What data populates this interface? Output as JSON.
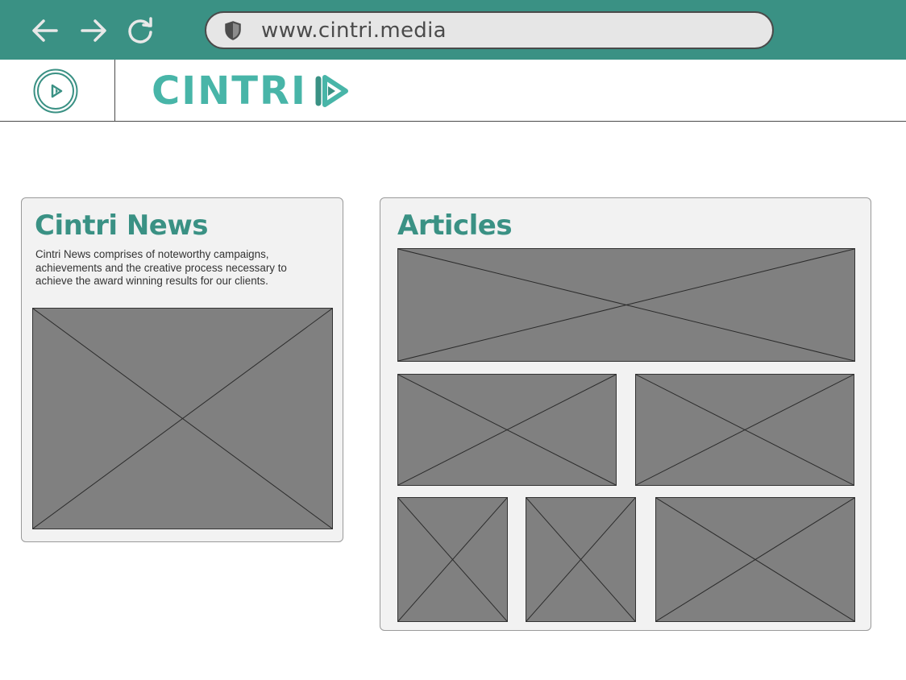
{
  "browser": {
    "url": "www.cintri.media",
    "icons": {
      "back": "arrow-left-icon",
      "forward": "arrow-right-icon",
      "reload": "reload-icon",
      "security": "shield-icon"
    },
    "colors": {
      "bar": "#3a9184",
      "url_bg": "#e6e6e6"
    }
  },
  "header": {
    "brand_name": "CINTRI",
    "icons": {
      "menu": "play-circle-icon",
      "brand_mark": "play-hexagon-icon"
    },
    "colors": {
      "brand": "#48b5a8"
    }
  },
  "news": {
    "title": "Cintri News",
    "description_lines": [
      "Cintri News comprises of noteworthy campaigns,",
      "achievements and the creative process necessary to",
      "achieve the award winning results for our clients."
    ]
  },
  "articles": {
    "title": "Articles"
  },
  "colors": {
    "accent": "#3a9184",
    "placeholder": "#808080",
    "card_bg": "#f2f2f2"
  }
}
